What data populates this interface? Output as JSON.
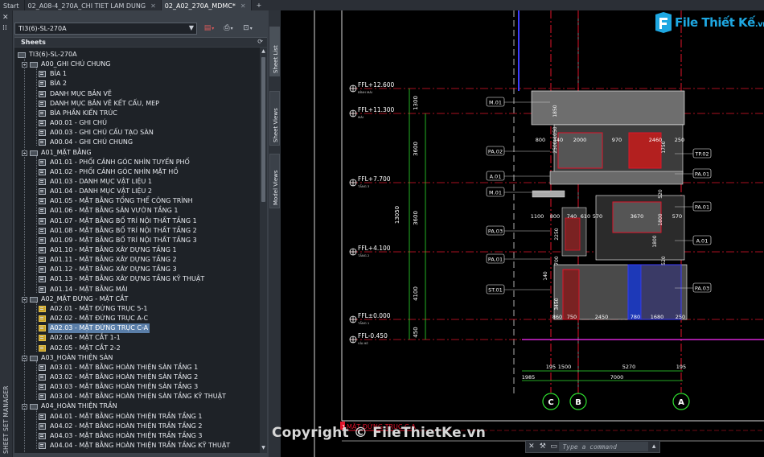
{
  "tabs": [
    {
      "label": "Start",
      "active": false,
      "closable": false
    },
    {
      "label": "02_A08-4_270A_CHI TIET LAM DUNG",
      "active": false,
      "closable": true
    },
    {
      "label": "02_A02_270A_MDMC*",
      "active": true,
      "closable": true
    }
  ],
  "palette": {
    "title": "SHEET SET MANAGER",
    "sheet_set": "TI3(6)-SL-270A",
    "section_label": "Sheets",
    "side_tabs": [
      "Sheet List",
      "Sheet Views",
      "Model Views"
    ],
    "tree": [
      {
        "level": 0,
        "type": "root",
        "label": "TI3(6)-SL-270A"
      },
      {
        "level": 1,
        "type": "folder",
        "label": "A00_GHI CHÚ CHUNG"
      },
      {
        "level": 2,
        "type": "sheet",
        "label": "BÌA 1"
      },
      {
        "level": 2,
        "type": "sheet",
        "label": "BÌA 2"
      },
      {
        "level": 2,
        "type": "sheet",
        "label": "DANH MỤC BẢN VẼ"
      },
      {
        "level": 2,
        "type": "sheet",
        "label": "DANH MỤC BẢN VẼ KẾT CẤU, MEP"
      },
      {
        "level": 2,
        "type": "sheet",
        "label": "BÌA PHẦN KIẾN TRÚC"
      },
      {
        "level": 2,
        "type": "sheet",
        "label": "A00.01 - GHI CHÚ"
      },
      {
        "level": 2,
        "type": "sheet",
        "label": "A00.03 - GHI CHÚ CẤU TẠO SÀN"
      },
      {
        "level": 2,
        "type": "sheet",
        "label": "A00.04 - GHI CHÚ CHUNG"
      },
      {
        "level": 1,
        "type": "folder",
        "label": "A01_MẶT BẰNG"
      },
      {
        "level": 2,
        "type": "sheet",
        "label": "A01.01 - PHỐI CẢNH GÓC NHÌN TUYẾN PHỐ"
      },
      {
        "level": 2,
        "type": "sheet",
        "label": "A01.02 - PHỐI CẢNH GÓC NHÌN MẶT HỒ"
      },
      {
        "level": 2,
        "type": "sheet",
        "label": "A01.03 - DANH MỤC VẬT LIỆU 1"
      },
      {
        "level": 2,
        "type": "sheet",
        "label": "A01.04 - DANH MỤC VẬT LIỆU 2"
      },
      {
        "level": 2,
        "type": "sheet",
        "label": "A01.05 - MẶT BẰNG TỔNG THỂ CÔNG TRÌNH"
      },
      {
        "level": 2,
        "type": "sheet",
        "label": "A01.06 - MẶT BẰNG SÂN VƯỜN TẦNG 1"
      },
      {
        "level": 2,
        "type": "sheet",
        "label": "A01.07 - MẶT BẰNG BỐ TRÍ NỘI THẤT TẦNG 1"
      },
      {
        "level": 2,
        "type": "sheet",
        "label": "A01.08 - MẶT BẰNG BỐ TRÍ NỘI THẤT TẦNG 2"
      },
      {
        "level": 2,
        "type": "sheet",
        "label": "A01.09 - MẶT BẰNG BỐ TRÍ NỘI THẤT TẦNG 3"
      },
      {
        "level": 2,
        "type": "sheet",
        "label": "A01.10 - MẶT BẰNG XÂY DỰNG TẦNG 1"
      },
      {
        "level": 2,
        "type": "sheet",
        "label": "A01.11 - MẶT BẰNG XÂY DỰNG TẦNG 2"
      },
      {
        "level": 2,
        "type": "sheet",
        "label": "A01.12 - MẶT BẰNG XÂY DỰNG TẦNG 3"
      },
      {
        "level": 2,
        "type": "sheet",
        "label": "A01.13 - MẶT BẰNG XÂY DỰNG TẦNG KỸ THUẬT"
      },
      {
        "level": 2,
        "type": "sheet",
        "label": "A01.14 - MẶT BẰNG MÁI"
      },
      {
        "level": 1,
        "type": "folder",
        "label": "A02_MẶT ĐỨNG - MẶT CẮT"
      },
      {
        "level": 2,
        "type": "sheet-warn",
        "label": "A02.01 - MẶT ĐỨNG TRỤC 5-1"
      },
      {
        "level": 2,
        "type": "sheet-warn",
        "label": "A02.02 - MẶT ĐỨNG TRỤC A-C"
      },
      {
        "level": 2,
        "type": "sheet-warn",
        "label": "A02.03 - MẶT ĐỨNG TRỤC C-A",
        "selected": true
      },
      {
        "level": 2,
        "type": "sheet-warn",
        "label": "A02.04 - MẶT CẮT 1-1"
      },
      {
        "level": 2,
        "type": "sheet-warn",
        "label": "A02.05 - MẶT CẮT 2-2"
      },
      {
        "level": 1,
        "type": "folder",
        "label": "A03_HOÀN THIỆN SÀN"
      },
      {
        "level": 2,
        "type": "sheet",
        "label": "A03.01 - MẶT BẰNG HOÀN THIỆN SÀN TẦNG 1"
      },
      {
        "level": 2,
        "type": "sheet",
        "label": "A03.02 - MẶT BẰNG HOÀN THIỆN SÀN TẦNG 2"
      },
      {
        "level": 2,
        "type": "sheet",
        "label": "A03.03 - MẶT BẰNG HOÀN THIỆN SÀN TẦNG 3"
      },
      {
        "level": 2,
        "type": "sheet",
        "label": "A03.04 - MẶT BẰNG HOÀN THIỆN SÀN TẦNG KỸ THUẬT"
      },
      {
        "level": 1,
        "type": "folder",
        "label": "A04_HOÀN THIỆN TRẦN"
      },
      {
        "level": 2,
        "type": "sheet",
        "label": "A04.01 - MẶT BẰNG HOÀN THIỆN TRẦN TẦNG 1"
      },
      {
        "level": 2,
        "type": "sheet",
        "label": "A04.02 - MẶT BẰNG HOÀN THIỆN TRẦN TẦNG 2"
      },
      {
        "level": 2,
        "type": "sheet",
        "label": "A04.03 - MẶT BẰNG HOÀN THIỆN TRẦN TẦNG 3"
      },
      {
        "level": 2,
        "type": "sheet",
        "label": "A04.04 - MẶT BẰNG HOÀN THIỆN TRẦN TẦNG KỸ THUẬT"
      }
    ]
  },
  "drawing": {
    "levels": [
      {
        "label": "FFL+12.600",
        "sub": "ĐỈNH MÁI"
      },
      {
        "label": "FFL+11.300",
        "sub": "MÁI"
      },
      {
        "label": "FFL+7.700",
        "sub": "TẦNG 3"
      },
      {
        "label": "FFL+4.100",
        "sub": "TẦNG 2"
      },
      {
        "label": "FFL±0.000",
        "sub": "TẦNG 1"
      },
      {
        "label": "FFL-0.450",
        "sub": "VỈA HÈ"
      }
    ],
    "vertical_dims": [
      "1300",
      "3600",
      "3600",
      "13050",
      "4100",
      "450"
    ],
    "material_tags_left": [
      "M.01",
      "PA.02",
      "A.01",
      "M.01",
      "PA.03",
      "PA.01",
      "ST.01"
    ],
    "material_tags_right": [
      "TP.02",
      "PA.01",
      "PA.01",
      "A.01",
      "PA.03"
    ],
    "dims_top_row": [
      "800",
      "440",
      "2000",
      "970",
      "2460",
      "250"
    ],
    "dims_mid_row": [
      "1100",
      "800",
      "740",
      "610",
      "570",
      "3670",
      "570"
    ],
    "dims_bottom_row": [
      "860",
      "750",
      "2450",
      "780",
      "1680",
      "250"
    ],
    "dims_vertical_small": [
      "1850",
      "1050",
      "2500",
      "1750",
      "520",
      "1800",
      "2250",
      "1800",
      "700",
      "520",
      "140",
      "3450"
    ],
    "axis_dims_row1": [
      "195",
      "1500",
      "5270",
      "195"
    ],
    "axis_dims_row2": [
      "1985",
      "7000"
    ],
    "axes": [
      "C",
      "B",
      "A"
    ],
    "sheet_title": "MẶT ĐỨNG TRỤC C-A",
    "sheet_title_prefix": "1"
  },
  "commandline": {
    "placeholder": "Type a command"
  },
  "watermark": {
    "logo_text": "File Thiết Kế",
    "logo_tld": ".vn",
    "copyright": "Copyright © FileThietKe.vn"
  },
  "colors": {
    "accent": "#5a7ea8",
    "cad_red": "#e0142a",
    "cad_blue": "#3c3cff",
    "cad_magenta": "#ff2dff",
    "cad_green": "#2fe02f"
  }
}
